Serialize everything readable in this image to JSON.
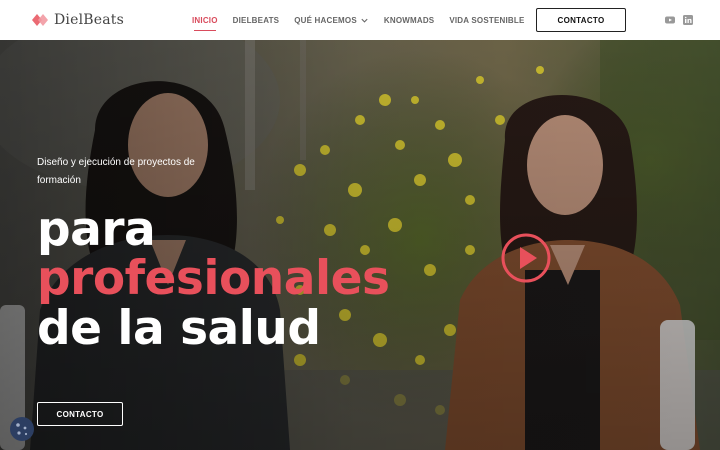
{
  "header": {
    "logo_text": "DielBeats",
    "nav": [
      {
        "label": "INICIO",
        "active": true
      },
      {
        "label": "DIELBEATS",
        "active": false
      },
      {
        "label": "QUÉ HACEMOS",
        "active": false,
        "dropdown": true
      },
      {
        "label": "KNOWMADS",
        "active": false
      },
      {
        "label": "VIDA SOSTENIBLE",
        "active": false
      }
    ],
    "cta_label": "CONTACTO",
    "social_icons": [
      "youtube-icon",
      "linkedin-icon"
    ]
  },
  "hero": {
    "subtitle": "Diseño y ejecución de proyectos de formación",
    "title_line1": "para",
    "title_line2": "profesionales",
    "title_line3": "de la salud",
    "cta_label": "CONTACTO"
  },
  "colors": {
    "accent": "#e8505b",
    "nav_active": "#d94b5c",
    "nav_text": "#666666",
    "cookie": "#2c3e62"
  }
}
